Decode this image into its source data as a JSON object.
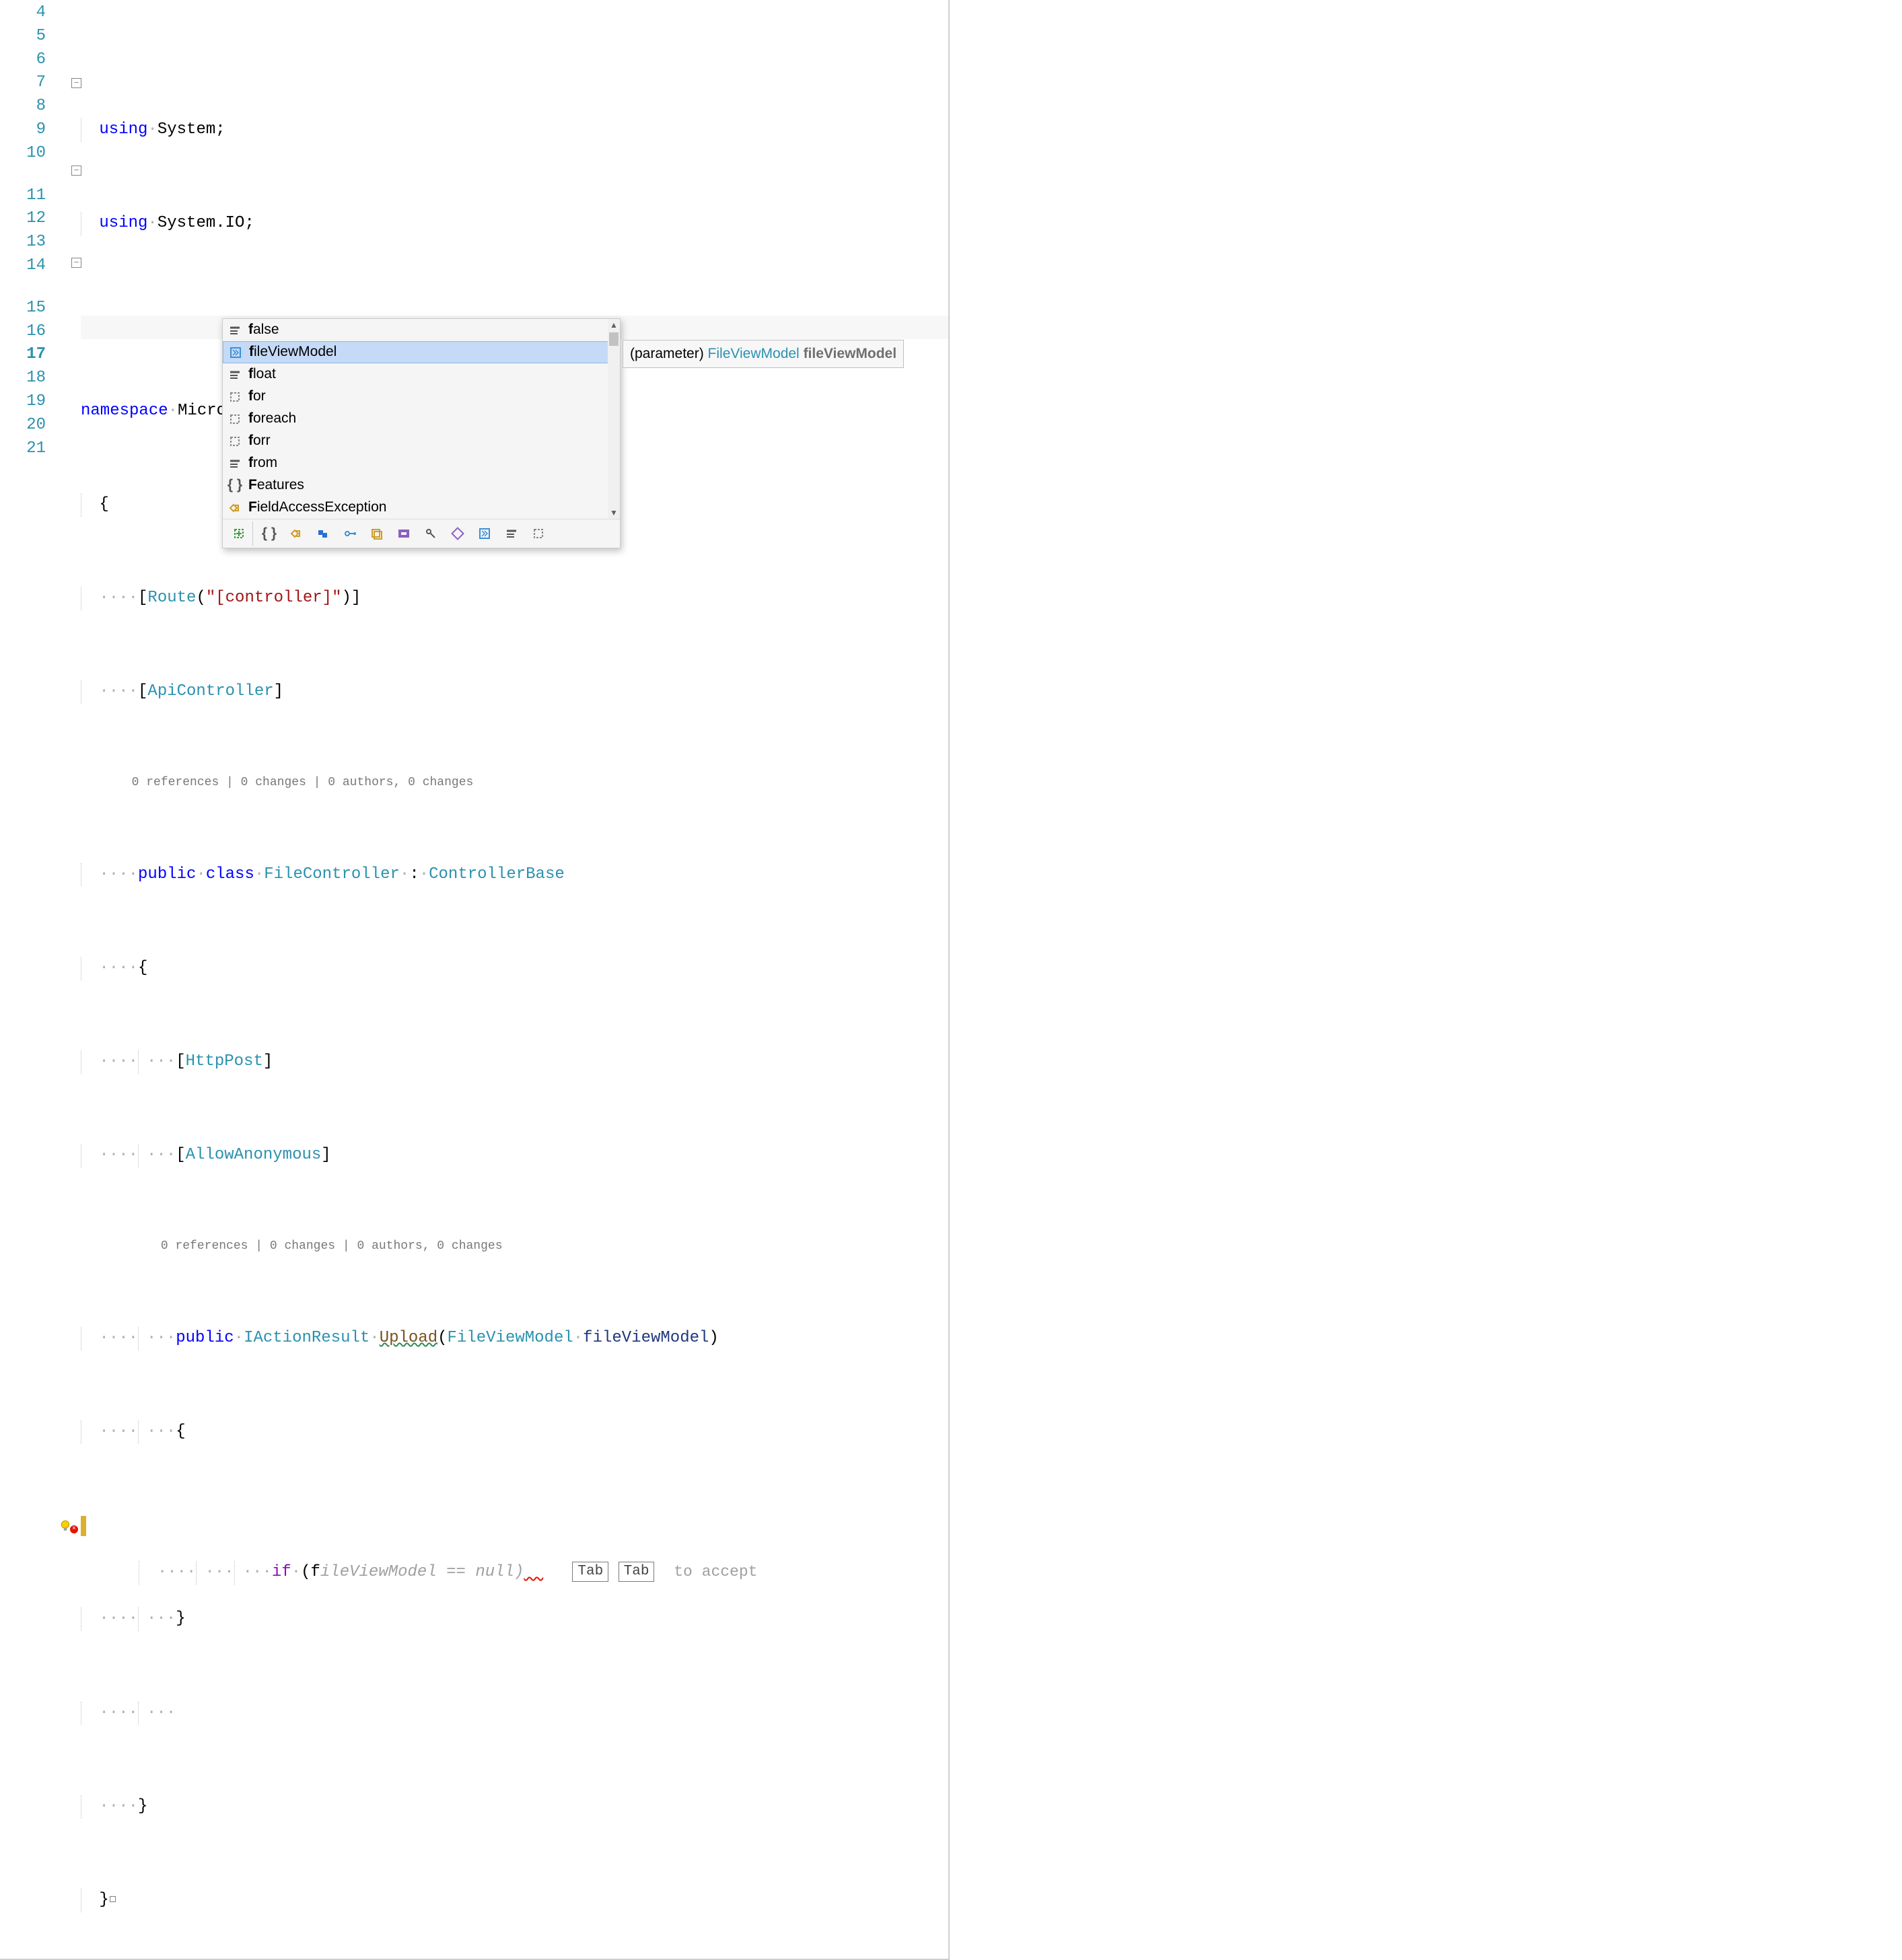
{
  "line_numbers": [
    "4",
    "5",
    "6",
    "7",
    "8",
    "9",
    "10",
    "11",
    "12",
    "13",
    "14",
    "15",
    "16",
    "17",
    "18",
    "19",
    "20",
    "21"
  ],
  "active_line": "17",
  "codelens1": "0 references | 0 changes | 0 authors, 0 changes",
  "codelens2": "0 references | 0 changes | 0 authors, 0 changes",
  "code": {
    "l4": {
      "kw": "using",
      "rest": "System;"
    },
    "l5": {
      "kw": "using",
      "rest": "System.IO;"
    },
    "l7": {
      "kw": "namespace",
      "rest": "Microsoft.eShopWeb.Web.Controllers"
    },
    "l8": "{",
    "l9": {
      "attr": "Route",
      "arg": "\"[controller]\""
    },
    "l10": {
      "attr": "ApiController"
    },
    "l11": {
      "kw1": "public",
      "kw2": "class",
      "name": "FileController",
      "base": "ControllerBase"
    },
    "l12": "{",
    "l13": {
      "attr": "HttpPost"
    },
    "l14": {
      "attr": "AllowAnonymous"
    },
    "l15": {
      "kw1": "public",
      "rettype": "IActionResult",
      "method": "Upload",
      "ptype": "FileViewModel",
      "pname": "fileViewModel"
    },
    "l16": "{",
    "l17": {
      "kw": "if",
      "typed": "f",
      "ghost": "ileViewModel == null)"
    },
    "l18": "}",
    "l20": "}",
    "l21": "}"
  },
  "tabhint": {
    "tab": "Tab",
    "accept": "to accept"
  },
  "completion": {
    "selected_index": 1,
    "items": [
      {
        "icon": "const",
        "label": "false",
        "match": "f",
        "rest": "alse"
      },
      {
        "icon": "param",
        "label": "fileViewModel",
        "match": "f",
        "rest": "ileViewModel"
      },
      {
        "icon": "const",
        "label": "float",
        "match": "f",
        "rest": "loat"
      },
      {
        "icon": "snippet",
        "label": "for",
        "match": "f",
        "rest": "or"
      },
      {
        "icon": "snippet",
        "label": "foreach",
        "match": "f",
        "rest": "oreach"
      },
      {
        "icon": "snippet",
        "label": "forr",
        "match": "f",
        "rest": "orr"
      },
      {
        "icon": "const",
        "label": "from",
        "match": "f",
        "rest": "rom"
      },
      {
        "icon": "class",
        "label": "Features",
        "match": "F",
        "rest": "eatures"
      },
      {
        "icon": "struct",
        "label": "FieldAccessException",
        "match": "F",
        "rest": "ieldAccessException"
      }
    ]
  },
  "tooltip": {
    "kind": "(parameter)",
    "type": "FileViewModel",
    "name": "fileViewModel"
  }
}
